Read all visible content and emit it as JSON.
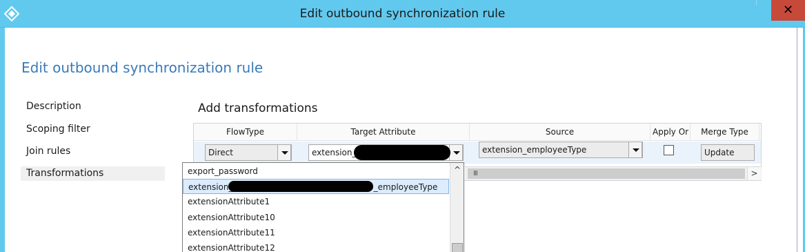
{
  "window": {
    "title": "Edit outbound synchronization rule",
    "close_glyph": "✕"
  },
  "page": {
    "heading": "Edit outbound synchronization rule",
    "section_heading": "Add transformations"
  },
  "nav": {
    "items": [
      {
        "label": "Description",
        "selected": false
      },
      {
        "label": "Scoping filter",
        "selected": false
      },
      {
        "label": "Join rules",
        "selected": false
      },
      {
        "label": "Transformations",
        "selected": true
      }
    ]
  },
  "grid": {
    "columns": [
      "FlowType",
      "Target Attribute",
      "Source",
      "Apply Or",
      "Merge Type"
    ],
    "row": {
      "flow_type": "Direct",
      "target_attribute": "extension_",
      "source": "extension_employeeType",
      "apply_once": false,
      "merge_type": "Update"
    }
  },
  "dropdown": {
    "items": [
      {
        "label": "export_password",
        "selected": false
      },
      {
        "label": "extension_",
        "suffix": "4_employeeType",
        "selected": true,
        "redacted": true
      },
      {
        "label": "extensionAttribute1",
        "selected": false
      },
      {
        "label": "extensionAttribute10",
        "selected": false
      },
      {
        "label": "extensionAttribute11",
        "selected": false
      },
      {
        "label": "extensionAttribute12",
        "selected": false
      }
    ]
  },
  "scroll": {
    "grip": "III",
    "right_arrow": ">",
    "up_arrow": "^"
  },
  "icons": {
    "app": "sync-diamond-icon",
    "close": "close-icon",
    "dropdown_arrow": "chevron-down-icon"
  },
  "colors": {
    "titlebar": "#62c9ee",
    "heading": "#3a7ab9",
    "close": "#c7493a",
    "row_bg": "#eaf3fb",
    "selected_item": "#dcecfc"
  }
}
